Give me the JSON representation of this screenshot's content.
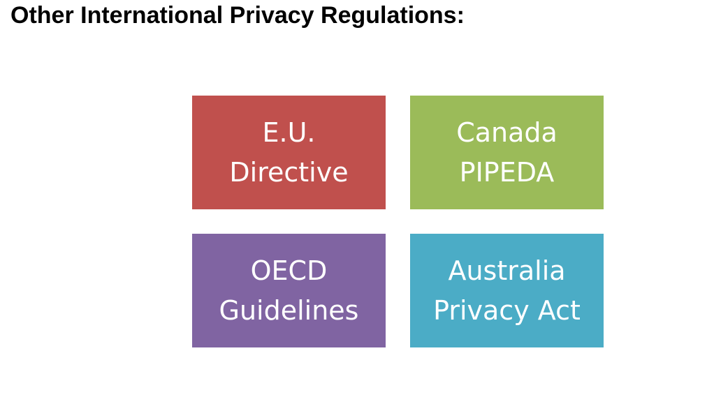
{
  "title": "Other International Privacy Regulations:",
  "boxes": [
    {
      "line1": "E.U.",
      "line2": "Directive",
      "color": "#C0504D"
    },
    {
      "line1": "Canada",
      "line2": "PIPEDA",
      "color": "#9BBB59"
    },
    {
      "line1": "OECD",
      "line2": "Guidelines",
      "color": "#8064A2"
    },
    {
      "line1": "Australia",
      "line2": "Privacy Act",
      "color": "#4BACC6"
    }
  ]
}
